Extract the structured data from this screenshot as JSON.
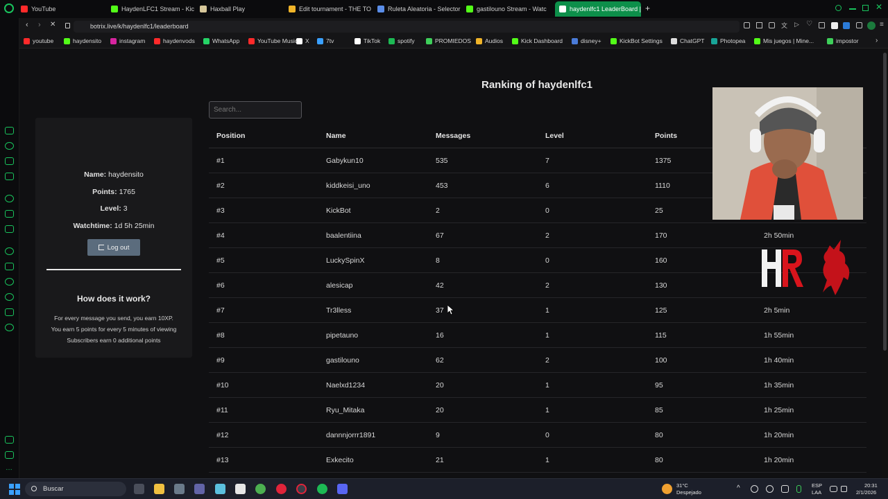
{
  "browser": {
    "tabs": [
      {
        "label": "YouTube",
        "color": "#ff2a2a"
      },
      {
        "label": "HaydenLFC1 Stream - Kic",
        "color": "#53fc18"
      },
      {
        "label": "Haxball Play",
        "color": "#d7c79a"
      },
      {
        "label": "Edit tournament - THE TO",
        "color": "#f0b429"
      },
      {
        "label": "Ruleta Aleatoria - Selector",
        "color": "#5a8de8"
      },
      {
        "label": "gastilouno Stream - Watc",
        "color": "#53fc18"
      },
      {
        "label": "haydenlfc1 LeaderBoard |",
        "color": "#ffffff",
        "active": true
      }
    ],
    "new_tab": "+",
    "url": "botrix.live/k/haydenlfc1/leaderboard",
    "bookmarks": [
      {
        "label": "youtube",
        "color": "#ff2a2a"
      },
      {
        "label": "haydensito",
        "color": "#53fc18"
      },
      {
        "label": "instagram",
        "color": "#d6249f"
      },
      {
        "label": "haydenvods",
        "color": "#ff2a2a"
      },
      {
        "label": "WhatsApp",
        "color": "#25d366"
      },
      {
        "label": "YouTube Music",
        "color": "#ff2a2a"
      },
      {
        "label": "X",
        "color": "#ffffff"
      },
      {
        "label": "7tv",
        "color": "#3aa0ff"
      },
      {
        "label": "TikTok",
        "color": "#ffffff"
      },
      {
        "label": "spotify",
        "color": "#1db954"
      },
      {
        "label": "PROMIEDOS",
        "color": "#3ecf5a"
      },
      {
        "label": "Audios",
        "color": "#f0b429"
      },
      {
        "label": "Kick Dashboard",
        "color": "#53fc18"
      },
      {
        "label": "disney+",
        "color": "#4a7bd8"
      },
      {
        "label": "KickBot Settings",
        "color": "#53fc18"
      },
      {
        "label": "ChatGPT",
        "color": "#dddddd"
      },
      {
        "label": "Photopea",
        "color": "#18a497"
      },
      {
        "label": "Mis juegos | Mine...",
        "color": "#53fc18"
      },
      {
        "label": "impostor",
        "color": "#3ecf5a"
      }
    ]
  },
  "page": {
    "title": "Ranking of haydenlfc1",
    "search_placeholder": "Search...",
    "profile": {
      "name_label": "Name:",
      "name_value": "haydensito",
      "points_label": "Points:",
      "points_value": "1765",
      "level_label": "Level:",
      "level_value": "3",
      "watch_label": "Watchtime:",
      "watch_value": "1d 5h 25min",
      "logout_label": "Log out"
    },
    "how": {
      "title": "How does it work?",
      "lines": [
        "For every message you send, you earn 10XP.",
        "You earn 5 points for every 5 minutes of viewing",
        "Subscribers earn 0 additional points"
      ]
    },
    "columns": [
      "Position",
      "Name",
      "Messages",
      "Level",
      "Points"
    ],
    "rows": [
      {
        "pos": "#1",
        "name": "Gabykun10",
        "msgs": "535",
        "level": "7",
        "points": "1375",
        "time": ""
      },
      {
        "pos": "#2",
        "name": "kiddkeisi_uno",
        "msgs": "453",
        "level": "6",
        "points": "1110",
        "time": ""
      },
      {
        "pos": "#3",
        "name": "KickBot",
        "msgs": "2",
        "level": "0",
        "points": "25",
        "time": ""
      },
      {
        "pos": "#4",
        "name": "baalentiina",
        "msgs": "67",
        "level": "2",
        "points": "170",
        "time": "2h 50min"
      },
      {
        "pos": "#5",
        "name": "LuckySpinX",
        "msgs": "8",
        "level": "0",
        "points": "160",
        "time": ""
      },
      {
        "pos": "#6",
        "name": "alesicap",
        "msgs": "42",
        "level": "2",
        "points": "130",
        "time": ""
      },
      {
        "pos": "#7",
        "name": "Tr3lless",
        "msgs": "37",
        "level": "1",
        "points": "125",
        "time": "2h 5min"
      },
      {
        "pos": "#8",
        "name": "pipetauno",
        "msgs": "16",
        "level": "1",
        "points": "115",
        "time": "1h 55min"
      },
      {
        "pos": "#9",
        "name": "gastilouno",
        "msgs": "62",
        "level": "2",
        "points": "100",
        "time": "1h 40min"
      },
      {
        "pos": "#10",
        "name": "Naelxd1234",
        "msgs": "20",
        "level": "1",
        "points": "95",
        "time": "1h 35min"
      },
      {
        "pos": "#11",
        "name": "Ryu_Mitaka",
        "msgs": "20",
        "level": "1",
        "points": "85",
        "time": "1h 25min"
      },
      {
        "pos": "#12",
        "name": "dannnjorrr1891",
        "msgs": "9",
        "level": "0",
        "points": "80",
        "time": "1h 20min"
      },
      {
        "pos": "#13",
        "name": "Exkecito",
        "msgs": "21",
        "level": "1",
        "points": "80",
        "time": "1h 20min"
      }
    ]
  },
  "taskbar": {
    "search_label": "Buscar",
    "weather_temp": "31°C",
    "weather_desc": "Despejado",
    "lang_top": "ESP",
    "lang_bottom": "LAA",
    "clock_time": "20:31",
    "clock_date": "2/1/2026"
  },
  "colors": {
    "accent": "#0d8f4a",
    "kick_green": "#53fc18",
    "logout_button": "#5b6c7d",
    "logo_red": "#d8141c"
  }
}
